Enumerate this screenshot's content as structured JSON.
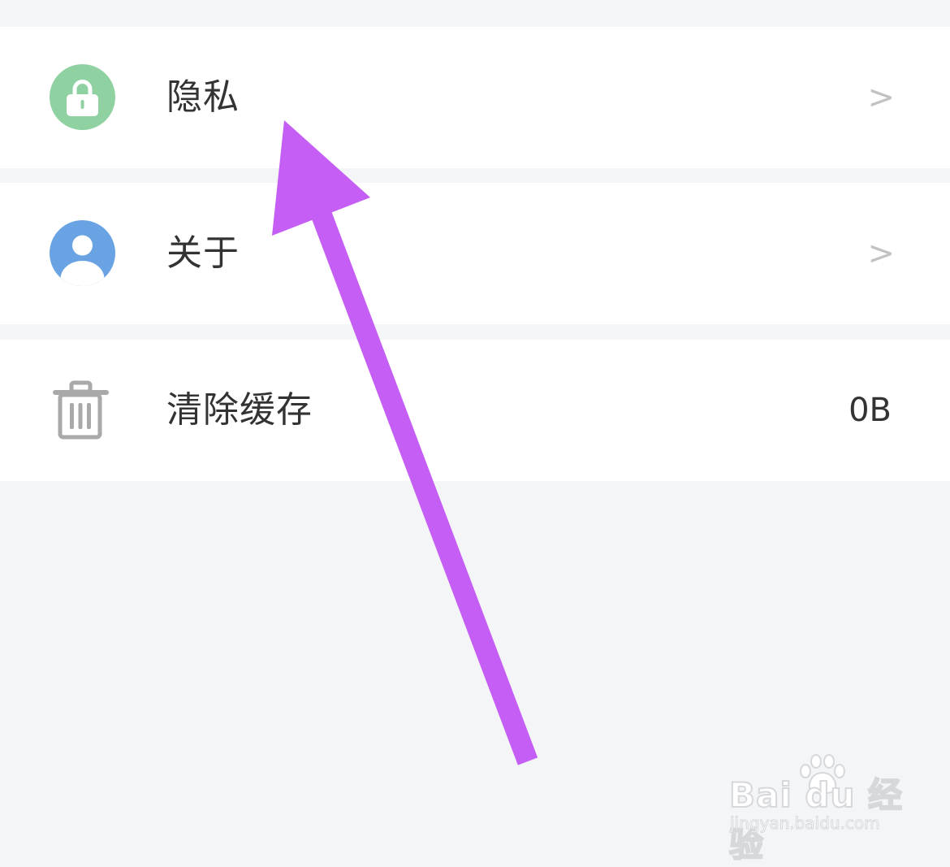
{
  "settings_list": [
    {
      "label": "隐私",
      "icon": "lock-icon",
      "trailing": ">"
    },
    {
      "label": "关于",
      "icon": "user-icon",
      "trailing": ">"
    },
    {
      "label": "清除缓存",
      "icon": "trash-icon",
      "value": "0B"
    }
  ],
  "colors": {
    "background": "#f4f5f7",
    "row_background": "#ffffff",
    "lock_icon_bg": "#8fd1a0",
    "user_icon_bg": "#6aa3e3",
    "trash_icon": "#a9a9a9",
    "chevron": "#c2c2c2",
    "text": "#333333",
    "annotation_arrow": "#c55ef5"
  },
  "watermark": {
    "brand": "Bai du 经验",
    "url": "jingyan.baidu.com"
  }
}
